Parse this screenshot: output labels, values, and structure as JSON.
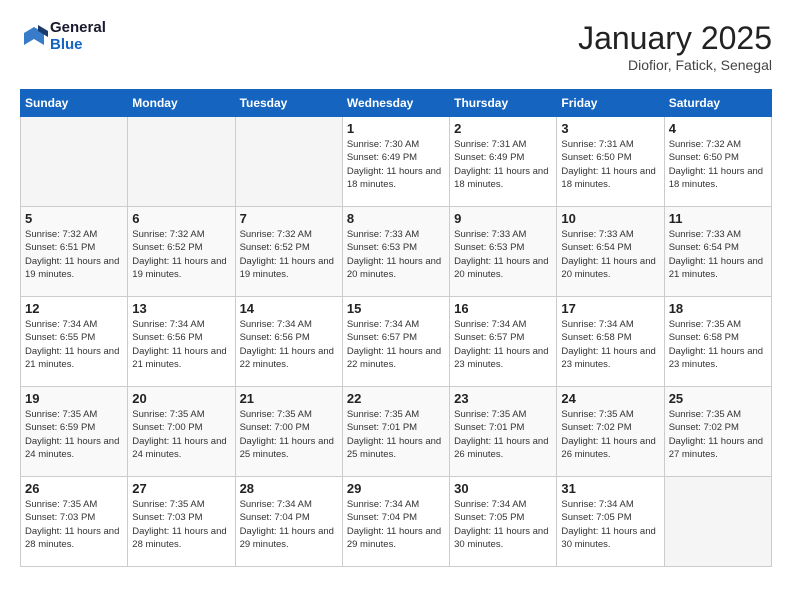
{
  "header": {
    "logo_line1": "General",
    "logo_line2": "Blue",
    "month": "January 2025",
    "location": "Diofior, Fatick, Senegal"
  },
  "weekdays": [
    "Sunday",
    "Monday",
    "Tuesday",
    "Wednesday",
    "Thursday",
    "Friday",
    "Saturday"
  ],
  "weeks": [
    [
      {
        "day": "",
        "info": ""
      },
      {
        "day": "",
        "info": ""
      },
      {
        "day": "",
        "info": ""
      },
      {
        "day": "1",
        "info": "Sunrise: 7:30 AM\nSunset: 6:49 PM\nDaylight: 11 hours and 18 minutes."
      },
      {
        "day": "2",
        "info": "Sunrise: 7:31 AM\nSunset: 6:49 PM\nDaylight: 11 hours and 18 minutes."
      },
      {
        "day": "3",
        "info": "Sunrise: 7:31 AM\nSunset: 6:50 PM\nDaylight: 11 hours and 18 minutes."
      },
      {
        "day": "4",
        "info": "Sunrise: 7:32 AM\nSunset: 6:50 PM\nDaylight: 11 hours and 18 minutes."
      }
    ],
    [
      {
        "day": "5",
        "info": "Sunrise: 7:32 AM\nSunset: 6:51 PM\nDaylight: 11 hours and 19 minutes."
      },
      {
        "day": "6",
        "info": "Sunrise: 7:32 AM\nSunset: 6:52 PM\nDaylight: 11 hours and 19 minutes."
      },
      {
        "day": "7",
        "info": "Sunrise: 7:32 AM\nSunset: 6:52 PM\nDaylight: 11 hours and 19 minutes."
      },
      {
        "day": "8",
        "info": "Sunrise: 7:33 AM\nSunset: 6:53 PM\nDaylight: 11 hours and 20 minutes."
      },
      {
        "day": "9",
        "info": "Sunrise: 7:33 AM\nSunset: 6:53 PM\nDaylight: 11 hours and 20 minutes."
      },
      {
        "day": "10",
        "info": "Sunrise: 7:33 AM\nSunset: 6:54 PM\nDaylight: 11 hours and 20 minutes."
      },
      {
        "day": "11",
        "info": "Sunrise: 7:33 AM\nSunset: 6:54 PM\nDaylight: 11 hours and 21 minutes."
      }
    ],
    [
      {
        "day": "12",
        "info": "Sunrise: 7:34 AM\nSunset: 6:55 PM\nDaylight: 11 hours and 21 minutes."
      },
      {
        "day": "13",
        "info": "Sunrise: 7:34 AM\nSunset: 6:56 PM\nDaylight: 11 hours and 21 minutes."
      },
      {
        "day": "14",
        "info": "Sunrise: 7:34 AM\nSunset: 6:56 PM\nDaylight: 11 hours and 22 minutes."
      },
      {
        "day": "15",
        "info": "Sunrise: 7:34 AM\nSunset: 6:57 PM\nDaylight: 11 hours and 22 minutes."
      },
      {
        "day": "16",
        "info": "Sunrise: 7:34 AM\nSunset: 6:57 PM\nDaylight: 11 hours and 23 minutes."
      },
      {
        "day": "17",
        "info": "Sunrise: 7:34 AM\nSunset: 6:58 PM\nDaylight: 11 hours and 23 minutes."
      },
      {
        "day": "18",
        "info": "Sunrise: 7:35 AM\nSunset: 6:58 PM\nDaylight: 11 hours and 23 minutes."
      }
    ],
    [
      {
        "day": "19",
        "info": "Sunrise: 7:35 AM\nSunset: 6:59 PM\nDaylight: 11 hours and 24 minutes."
      },
      {
        "day": "20",
        "info": "Sunrise: 7:35 AM\nSunset: 7:00 PM\nDaylight: 11 hours and 24 minutes."
      },
      {
        "day": "21",
        "info": "Sunrise: 7:35 AM\nSunset: 7:00 PM\nDaylight: 11 hours and 25 minutes."
      },
      {
        "day": "22",
        "info": "Sunrise: 7:35 AM\nSunset: 7:01 PM\nDaylight: 11 hours and 25 minutes."
      },
      {
        "day": "23",
        "info": "Sunrise: 7:35 AM\nSunset: 7:01 PM\nDaylight: 11 hours and 26 minutes."
      },
      {
        "day": "24",
        "info": "Sunrise: 7:35 AM\nSunset: 7:02 PM\nDaylight: 11 hours and 26 minutes."
      },
      {
        "day": "25",
        "info": "Sunrise: 7:35 AM\nSunset: 7:02 PM\nDaylight: 11 hours and 27 minutes."
      }
    ],
    [
      {
        "day": "26",
        "info": "Sunrise: 7:35 AM\nSunset: 7:03 PM\nDaylight: 11 hours and 28 minutes."
      },
      {
        "day": "27",
        "info": "Sunrise: 7:35 AM\nSunset: 7:03 PM\nDaylight: 11 hours and 28 minutes."
      },
      {
        "day": "28",
        "info": "Sunrise: 7:34 AM\nSunset: 7:04 PM\nDaylight: 11 hours and 29 minutes."
      },
      {
        "day": "29",
        "info": "Sunrise: 7:34 AM\nSunset: 7:04 PM\nDaylight: 11 hours and 29 minutes."
      },
      {
        "day": "30",
        "info": "Sunrise: 7:34 AM\nSunset: 7:05 PM\nDaylight: 11 hours and 30 minutes."
      },
      {
        "day": "31",
        "info": "Sunrise: 7:34 AM\nSunset: 7:05 PM\nDaylight: 11 hours and 30 minutes."
      },
      {
        "day": "",
        "info": ""
      }
    ]
  ]
}
